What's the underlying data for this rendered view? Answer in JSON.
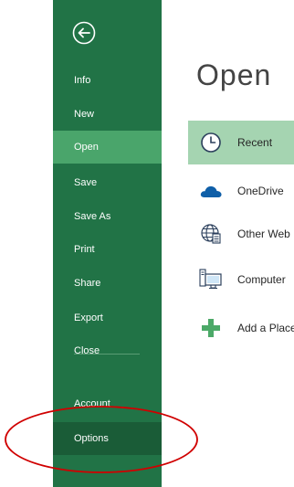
{
  "sidebar": {
    "back_icon": "back-arrow-circle-icon",
    "items": [
      {
        "label": "Info"
      },
      {
        "label": "New"
      },
      {
        "label": "Open"
      },
      {
        "label": "Save"
      },
      {
        "label": "Save As"
      },
      {
        "label": "Print"
      },
      {
        "label": "Share"
      },
      {
        "label": "Export"
      },
      {
        "label": "Close"
      }
    ],
    "account_label": "Account",
    "options_label": "Options",
    "active_item": "Open"
  },
  "main": {
    "title": "Open",
    "locations": [
      {
        "label": "Recent",
        "icon": "clock-icon",
        "selected": true
      },
      {
        "label": "OneDrive",
        "icon": "cloud-icon",
        "selected": false
      },
      {
        "label": "Other Web Locations",
        "icon": "globe-icon",
        "selected": false
      },
      {
        "label": "Computer",
        "icon": "computer-icon",
        "selected": false
      },
      {
        "label": "Add a Place",
        "icon": "plus-icon",
        "selected": false
      }
    ]
  },
  "annotation": {
    "highlight_target": "Options",
    "highlight_color": "#d00000"
  },
  "colors": {
    "sidebar": "#217346",
    "active_nav": "#4aa56b",
    "selected_location": "#a5d4b1",
    "accent_cloud": "#0f5fa8",
    "accent_plus": "#4ca968"
  }
}
